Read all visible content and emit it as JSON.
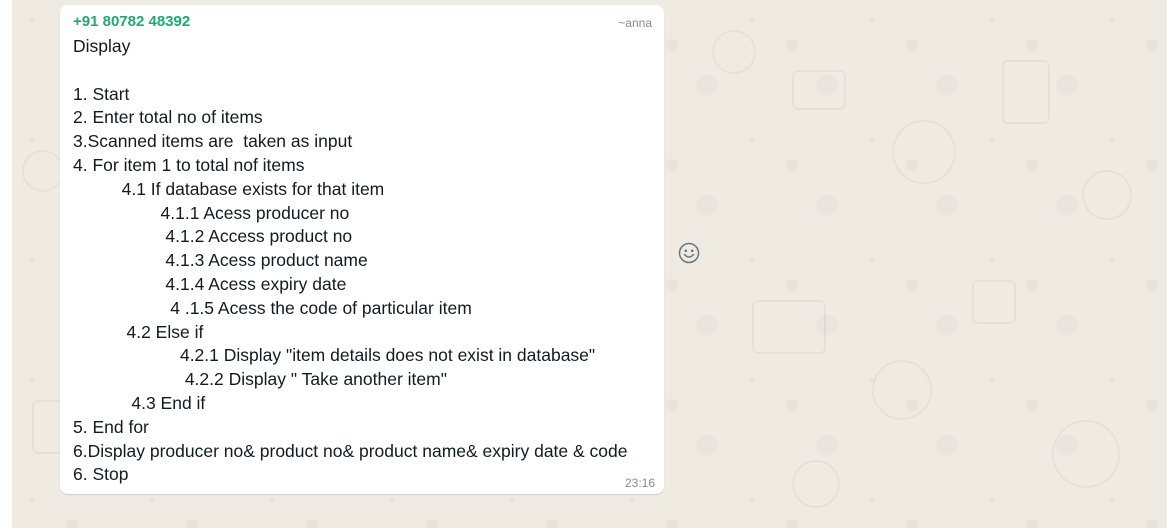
{
  "message": {
    "sender": "+91 80782 48392",
    "push_name": "~anna",
    "time": "23:16",
    "lines": [
      "Display",
      "",
      "1. Start",
      "2. Enter total no of items",
      "3.Scanned items are  taken as input",
      "4. For item 1 to total nof items",
      "          4.1 If database exists for that item",
      "                  4.1.1 Acess producer no",
      "                   4.1.2 Access product no",
      "                   4.1.3 Acess product name",
      "                   4.1.4 Acess expiry date",
      "                    4 .1.5 Acess the code of particular item",
      "           4.2 Else if",
      "                      4.2.1 Display \"item details does not exist in database\"",
      "                       4.2.2 Display \" Take another item\"",
      "            4.3 End if",
      "5. End for",
      "6.Display producer no& product no& product name& expiry date & code",
      "6. Stop"
    ]
  },
  "icons": {
    "emoji": "smiley-face-icon"
  }
}
